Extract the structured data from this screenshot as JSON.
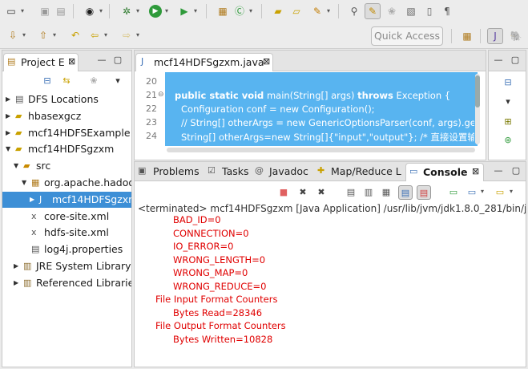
{
  "toolbar": {
    "quick_access": "Quick Access"
  },
  "package_explorer": {
    "tab_label": "Project E",
    "tree": [
      {
        "label": "DFS Locations",
        "indent": 0,
        "expanded": false,
        "icon": "dfs-icon"
      },
      {
        "label": "hbasexgcz",
        "indent": 0,
        "expanded": false,
        "icon": "project-icon"
      },
      {
        "label": "mcf14HDFSExample",
        "indent": 0,
        "expanded": false,
        "icon": "project-icon"
      },
      {
        "label": "mcf14HDFSgzxm",
        "indent": 0,
        "expanded": true,
        "icon": "project-icon"
      },
      {
        "label": "src",
        "indent": 1,
        "expanded": true,
        "icon": "source-folder-icon"
      },
      {
        "label": "org.apache.hadoo",
        "indent": 2,
        "expanded": true,
        "icon": "package-icon"
      },
      {
        "label": "mcf14HDFSgzxm",
        "indent": 3,
        "expanded": false,
        "icon": "java-file-icon",
        "selected": true
      },
      {
        "label": "core-site.xml",
        "indent": 2,
        "expanded": null,
        "icon": "xml-file-icon"
      },
      {
        "label": "hdfs-site.xml",
        "indent": 2,
        "expanded": null,
        "icon": "xml-file-icon"
      },
      {
        "label": "log4j.properties",
        "indent": 2,
        "expanded": null,
        "icon": "properties-file-icon"
      },
      {
        "label": "JRE System Library [",
        "indent": 1,
        "expanded": false,
        "icon": "library-icon"
      },
      {
        "label": "Referenced Librarie",
        "indent": 1,
        "expanded": false,
        "icon": "library-icon"
      }
    ]
  },
  "editor": {
    "tab_label": "mcf14HDFSgzxm.java",
    "lines": [
      {
        "num": "20",
        "text": ""
      },
      {
        "num": "21",
        "text": ""
      },
      {
        "num": "22",
        "text": "Configuration conf = new Configuration();"
      },
      {
        "num": "23",
        "text": "// String[] otherArgs = new GenericOptionsParser(conf, args).getRem"
      },
      {
        "num": "24",
        "text": "String[] otherArgs=new String[]{\"input\",\"output\"}; /* 直接设置输入"
      }
    ],
    "line21": {
      "kw1": "public static void",
      "method": " main(String[] args) ",
      "kw2": "throws",
      "rest": " Exception {"
    }
  },
  "bottom_tabs": {
    "problems": "Problems",
    "tasks": "Tasks",
    "javadoc": "Javadoc",
    "mapreduce": "Map/Reduce L",
    "console": "Console"
  },
  "console": {
    "header": "<terminated> mcf14HDFSgzxm [Java Application] /usr/lib/jvm/jdk1.8.0_281/bin/j",
    "lines": [
      {
        "text": "BAD_ID=0",
        "indent": 2
      },
      {
        "text": "CONNECTION=0",
        "indent": 2
      },
      {
        "text": "IO_ERROR=0",
        "indent": 2
      },
      {
        "text": "WRONG_LENGTH=0",
        "indent": 2
      },
      {
        "text": "WRONG_MAP=0",
        "indent": 2
      },
      {
        "text": "WRONG_REDUCE=0",
        "indent": 2
      },
      {
        "text": "File Input Format Counters",
        "indent": 1
      },
      {
        "text": "Bytes Read=28346",
        "indent": 2
      },
      {
        "text": "File Output Format Counters",
        "indent": 1
      },
      {
        "text": "Bytes Written=10828",
        "indent": 2
      }
    ]
  },
  "colors": {
    "selection": "#3d8fd6",
    "editor_highlight": "#58b4f0",
    "console_text": "#e00000"
  }
}
